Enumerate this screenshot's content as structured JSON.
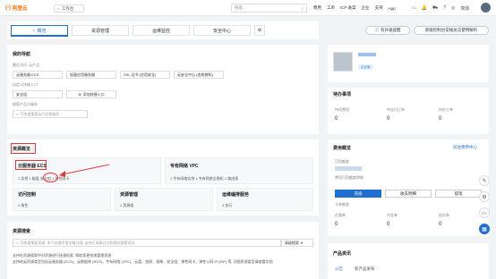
{
  "topbar": {
    "logo_mark": "(-)",
    "logo_text": "阿里云",
    "workbench": "工作台",
    "search_placeholder": "搜索...",
    "nav": [
      "费用",
      "工单",
      "ICP 备案",
      "企业",
      "支持",
      "App"
    ],
    "user_label": "简体"
  },
  "tabs": {
    "items": [
      "概览",
      "资源管理",
      "运维监控",
      "安全中心"
    ],
    "upgrade_btn": "有升级提醒",
    "overview_btn": "新版控制台常规总览使用解析"
  },
  "my_nav": {
    "title": "我的导航",
    "recent_label": "最近访问: 云产品",
    "recent_items": [
      "云服务器 ECS",
      "轻量应用服务器",
      "SSL 证书 (应用安全)",
      "云安全中心 (态势感知)"
    ],
    "custom_label": "自定义快捷入口",
    "custom_items": [
      "安全组",
      "添加快捷入口"
    ],
    "search_label": "搜索产品与服务",
    "search_placeholder": "可快速搜索云产品和服务"
  },
  "resource_overview": {
    "title": "资源概览",
    "ecs": {
      "title": "云服务器 ECS",
      "stats": "1 实例 1 磁盘 安全组 1 弹性网卡"
    },
    "vpc": {
      "title": "专有网络 VPC",
      "stats": "1 专有网络实例 1 专有网络交换机 1 路由表"
    },
    "access": {
      "title": "访问控制",
      "stats": "4 角色"
    },
    "resource_mgmt": {
      "title": "资源管理",
      "stats": "1 资源组"
    },
    "ops": {
      "title": "运维编排服务",
      "stats": "2 执行"
    }
  },
  "resource_search": {
    "title": "资源搜索",
    "placeholder": "可快速搜索资源, 多个关键字用空格分隔, 支持正则表达式和简化搜索语法",
    "btn": "高级搜索",
    "desc1": "支持在资源搜索中对资源进行快速检索, 帮助您更快地管理资源",
    "desc2": "支持的云资源类型包括云服务器 (ECS)、云数据库 (RDS)、专有网络 (VPC)、云盘、快照、镜像、安全组、弹性网卡、弹性公网 IP (EIP) 等, 详细资源类型请查看文档"
  },
  "user_card": {
    "badge": "企业版"
  },
  "todo": {
    "title": "待办事项",
    "items": [
      {
        "label": "待续费项",
        "value": "0"
      },
      {
        "label": "待支付订单",
        "value": "0"
      },
      {
        "label": "待办工单",
        "value": "0"
      }
    ]
  },
  "billing": {
    "title": "费用概览",
    "link": "前往费用中心",
    "balance_label": "可用额度",
    "balance_note": "费用可用额度明细",
    "buttons": [
      "充值",
      "收支明细",
      "提现"
    ],
    "card_title": "卡券额度",
    "items": [
      {
        "label": "优惠券",
        "value": "0"
      },
      {
        "label": "代金券",
        "value": "0"
      },
      {
        "label": "抵扣券",
        "value": "0"
      }
    ]
  },
  "products": {
    "title": "产品资讯",
    "tabs": [
      "公告",
      "新产品发布"
    ]
  },
  "colors": {
    "accent": "#1f6fd1",
    "brand": "#ff6a00",
    "annotation": "#e4393c"
  }
}
